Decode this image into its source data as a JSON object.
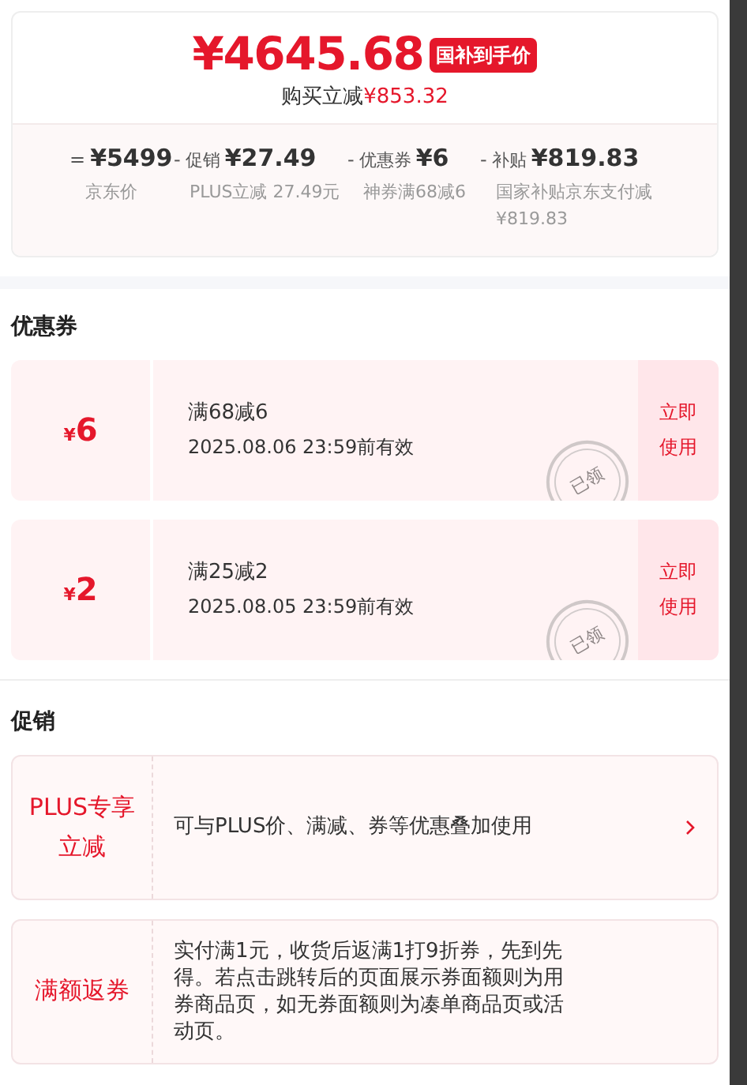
{
  "price": {
    "amount": "¥4645.68",
    "badge": "国补到手价",
    "saving_label": "购买立减",
    "saving_value": "¥853.32"
  },
  "breakdown": [
    {
      "sign": "=",
      "value": "¥5499",
      "note": "京东价"
    },
    {
      "sign": "-",
      "label": "促销",
      "value": "¥27.49",
      "note": "PLUS立减 27.49元"
    },
    {
      "sign": "-",
      "label": "优惠券",
      "value": "¥6",
      "note": "神券满68减6"
    },
    {
      "sign": "-",
      "label": "补贴",
      "value": "¥819.83",
      "note": "国家补贴京东支付减¥819.83"
    }
  ],
  "coupons": {
    "title": "优惠券",
    "items": [
      {
        "currency": "¥",
        "amount": "6",
        "condition": "满68减6",
        "validity": "2025.08.06 23:59前有效",
        "claimed": true,
        "stamp": "已领",
        "action": "立即使用"
      },
      {
        "currency": "¥",
        "amount": "2",
        "condition": "满25减2",
        "validity": "2025.08.05 23:59前有效",
        "claimed": true,
        "stamp": "已领",
        "action": "立即使用"
      }
    ]
  },
  "promotions": {
    "title": "促销",
    "items": [
      {
        "tag": "PLUS专享立减",
        "description": "可与PLUS价、满减、券等优惠叠加使用",
        "arrow": true
      },
      {
        "tag": "满额返券",
        "description": "实付满1元，收货后返满1打9折券，先到先得。若点击跳转后的页面展示券面额则为用券商品页，如无券面额则为凑单商品页或活动页。",
        "arrow": false
      }
    ]
  }
}
